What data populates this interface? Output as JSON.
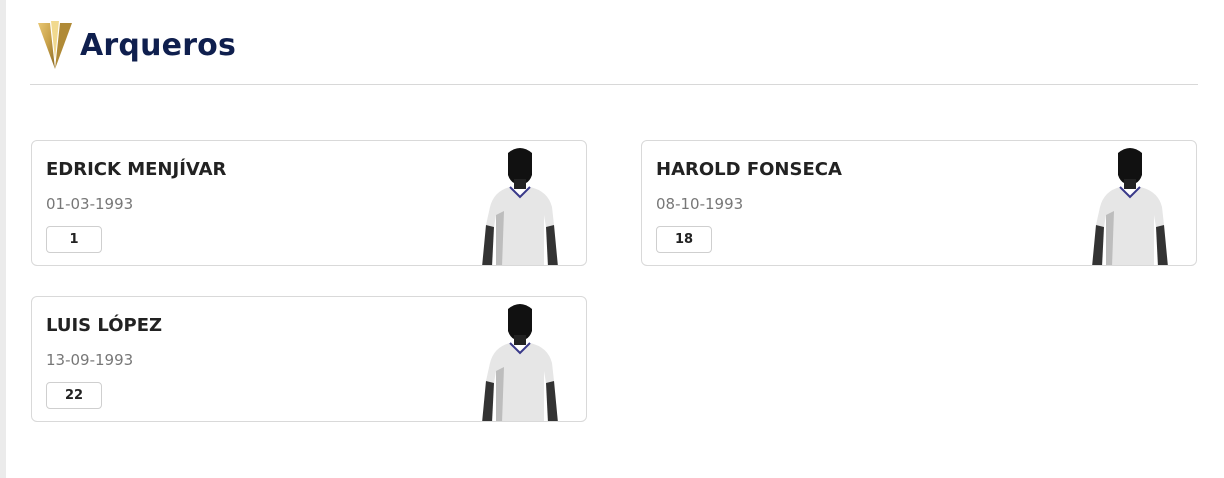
{
  "section": {
    "title": "Arqueros",
    "logo_icon": "gold-cup-logo-icon",
    "title_color": "#0f1f4e",
    "logo_color": "#c9a24a"
  },
  "players": [
    {
      "name": "EDRICK MENJÍVAR",
      "birthdate": "01-03-1993",
      "number": "1",
      "photo_icon": "player-silhouette-icon"
    },
    {
      "name": "HAROLD FONSECA",
      "birthdate": "08-10-1993",
      "number": "18",
      "photo_icon": "player-silhouette-icon"
    },
    {
      "name": "LUIS LÓPEZ",
      "birthdate": "13-09-1993",
      "number": "22",
      "photo_icon": "player-silhouette-icon"
    }
  ]
}
